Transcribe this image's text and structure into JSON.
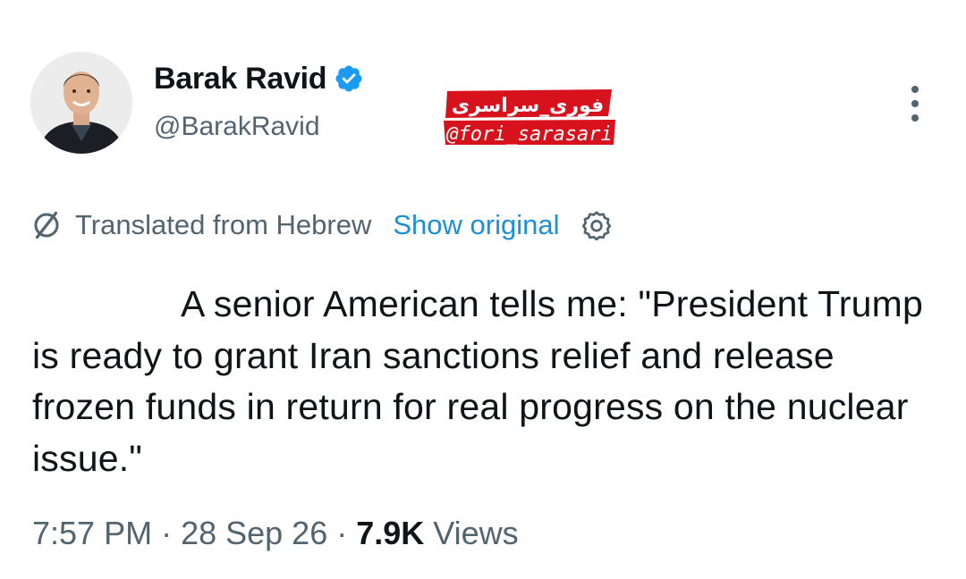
{
  "tweet": {
    "display_name": "Barak Ravid",
    "handle": "@BarakRavid",
    "translation_notice": "Translated from Hebrew",
    "show_original_label": "Show original",
    "text": "A senior American tells me: \"President Trump is ready to grant Iran sanctions relief and release frozen funds in return for real progress on the nuclear issue.\"",
    "time": "7:57 PM",
    "separator": "·",
    "date": "28 Sep 26",
    "views_count": "7.9K",
    "views_label": "Views"
  },
  "watermark": {
    "persian_text": "فوری_سراسری",
    "handle": "@fori_sarasari"
  },
  "icons": {
    "verified": "verified-badge-icon",
    "more": "more-dots-icon",
    "translate": "globe-slash-icon",
    "settings": "gear-icon"
  },
  "colors": {
    "accent": "#1d9bf0",
    "watermark_red": "#d8121d",
    "secondary_text": "#536471"
  }
}
